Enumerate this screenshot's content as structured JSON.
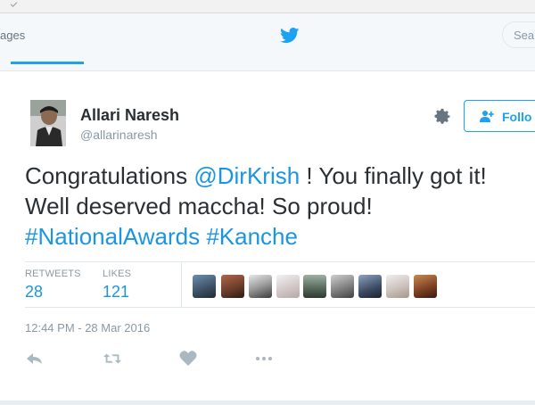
{
  "nav": {
    "partial_label": "ages",
    "search_placeholder": "Sea"
  },
  "tweet": {
    "author_name": "Allari Naresh",
    "author_handle": "@allarinaresh",
    "follow_label": "Follo",
    "text_line1_prefix": "Congratulations ",
    "text_mention": "@DirKrish",
    "text_line1_suffix": " ! You finally got it!",
    "text_line2": "Well deserved maccha! So proud!",
    "hashtag1": "#NationalAwards",
    "hashtag2": "#Kanche",
    "retweets_label": "RETWEETS",
    "retweets_count": "28",
    "likes_label": "LIKES",
    "likes_count": "121",
    "timestamp": "12:44 PM - 28 Mar 2016"
  },
  "colors": {
    "brand": "#1da1f2",
    "link": "#1b95e0",
    "text": "#292f33",
    "muted": "#8899a6"
  },
  "icons": [
    "twitter-bird-icon",
    "gear-icon",
    "follow-person-plus-icon",
    "reply-icon",
    "retweet-icon",
    "like-heart-icon",
    "more-icon"
  ]
}
